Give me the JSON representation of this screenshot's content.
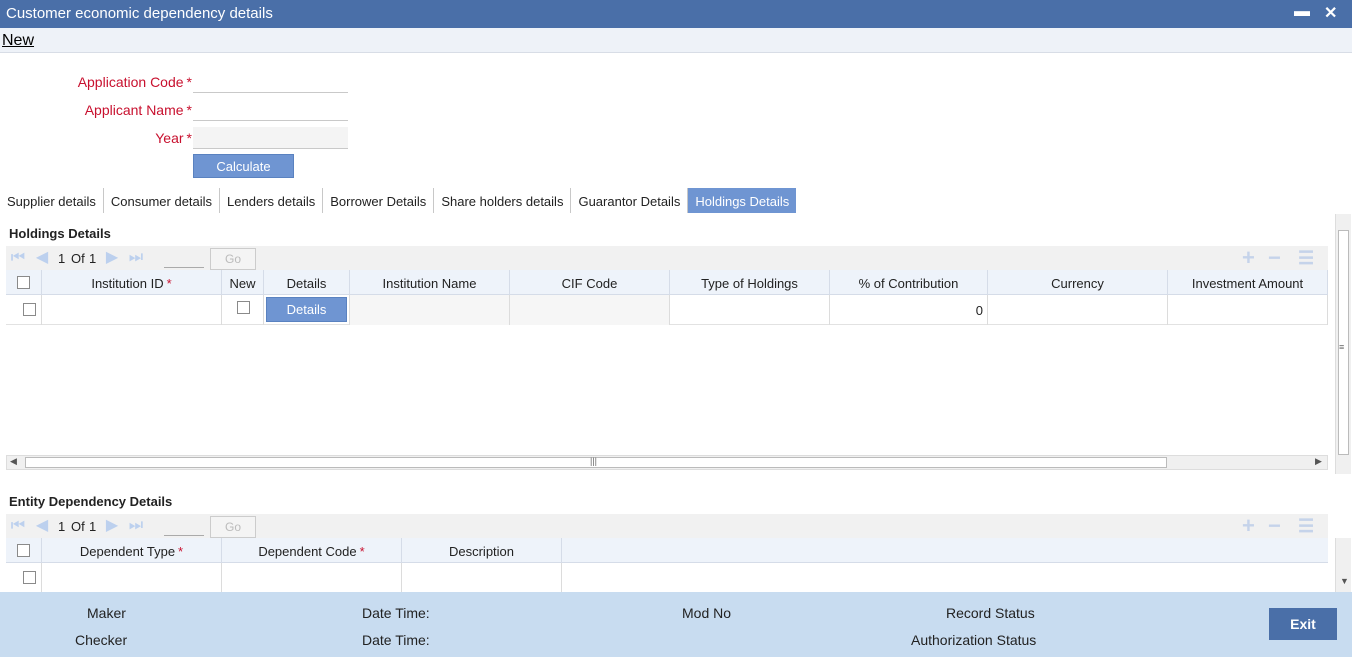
{
  "window": {
    "title": "Customer economic dependency details",
    "minimize": "▬",
    "close": "✕"
  },
  "toolbar": {
    "new_label": "New"
  },
  "form": {
    "application_code_label": "Application Code",
    "applicant_name_label": "Applicant Name",
    "year_label": "Year",
    "required_mark": "*",
    "calculate_label": "Calculate"
  },
  "tabs": [
    {
      "label": "Supplier details"
    },
    {
      "label": "Consumer details"
    },
    {
      "label": "Lenders details"
    },
    {
      "label": "Borrower Details"
    },
    {
      "label": "Share holders details"
    },
    {
      "label": "Guarantor Details"
    },
    {
      "label": "Holdings Details",
      "active": true
    }
  ],
  "holdings": {
    "title": "Holdings Details",
    "pager": {
      "current": "1",
      "of": "Of",
      "total": "1",
      "go": "Go"
    },
    "columns": {
      "institution_id": "Institution ID",
      "new": "New",
      "details": "Details",
      "institution_name": "Institution Name",
      "cif_code": "CIF Code",
      "type_of_holdings": "Type of Holdings",
      "pct_contribution": "% of Contribution",
      "currency": "Currency",
      "investment_amount": "Investment Amount"
    },
    "row": {
      "details_button": "Details",
      "pct_contribution": "0"
    }
  },
  "entity": {
    "title": "Entity Dependency Details",
    "pager": {
      "current": "1",
      "of": "Of",
      "total": "1",
      "go": "Go"
    },
    "columns": {
      "dependent_type": "Dependent Type",
      "dependent_code": "Dependent Code",
      "description": "Description"
    }
  },
  "footer": {
    "maker": "Maker",
    "checker": "Checker",
    "date_time": "Date Time:",
    "mod_no": "Mod No",
    "record_status": "Record Status",
    "authorization_status": "Authorization Status",
    "exit": "Exit"
  }
}
